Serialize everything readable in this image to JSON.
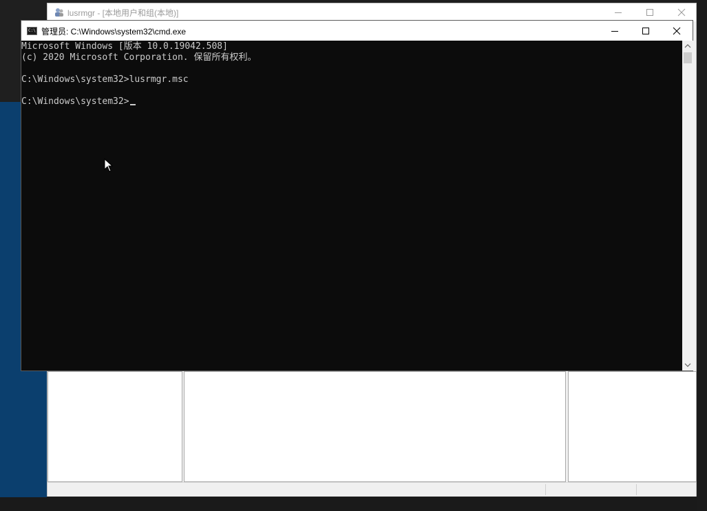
{
  "background_window": {
    "title": "lusrmgr - [本地用户和组(本地)]",
    "controls": {
      "minimize_icon": "minimize-icon",
      "maximize_icon": "maximize-icon",
      "close_icon": "close-icon"
    }
  },
  "cmd_window": {
    "title": "管理员: C:\\Windows\\system32\\cmd.exe",
    "controls": {
      "minimize_icon": "minimize-icon",
      "maximize_icon": "maximize-icon",
      "close_icon": "close-icon"
    },
    "console_lines": [
      "Microsoft Windows [版本 10.0.19042.508]",
      "(c) 2020 Microsoft Corporation. 保留所有权利。",
      "",
      "C:\\Windows\\system32>lusrmgr.msc",
      "",
      "C:\\Windows\\system32>"
    ],
    "colors": {
      "console_bg": "#0c0c0c",
      "console_text": "#cccccc"
    }
  }
}
